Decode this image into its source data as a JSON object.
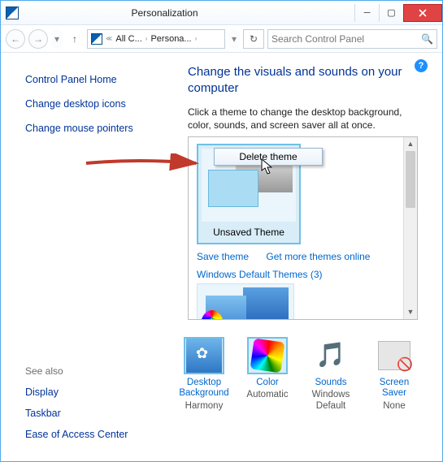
{
  "titlebar": {
    "title": "Personalization"
  },
  "toolbar": {
    "crumb1": "All C...",
    "crumb2": "Persona...",
    "search_placeholder": "Search Control Panel"
  },
  "sidebar": {
    "home": "Control Panel Home",
    "link1": "Change desktop icons",
    "link2": "Change mouse pointers"
  },
  "see_also": {
    "header": "See also",
    "l1": "Display",
    "l2": "Taskbar",
    "l3": "Ease of Access Center"
  },
  "main": {
    "heading": "Change the visuals and sounds on your computer",
    "subtext": "Click a theme to change the desktop background, color, sounds, and screen saver all at once.",
    "context_menu": "Delete theme",
    "theme_label": "Unsaved Theme",
    "save_link": "Save theme",
    "more_link": "Get more themes online",
    "section": "Windows Default Themes (3)"
  },
  "bottom": {
    "i1_title": "Desktop Background",
    "i1_val": "Harmony",
    "i2_title": "Color",
    "i2_val": "Automatic",
    "i3_title": "Sounds",
    "i3_val": "Windows Default",
    "i4_title": "Screen Saver",
    "i4_val": "None"
  }
}
